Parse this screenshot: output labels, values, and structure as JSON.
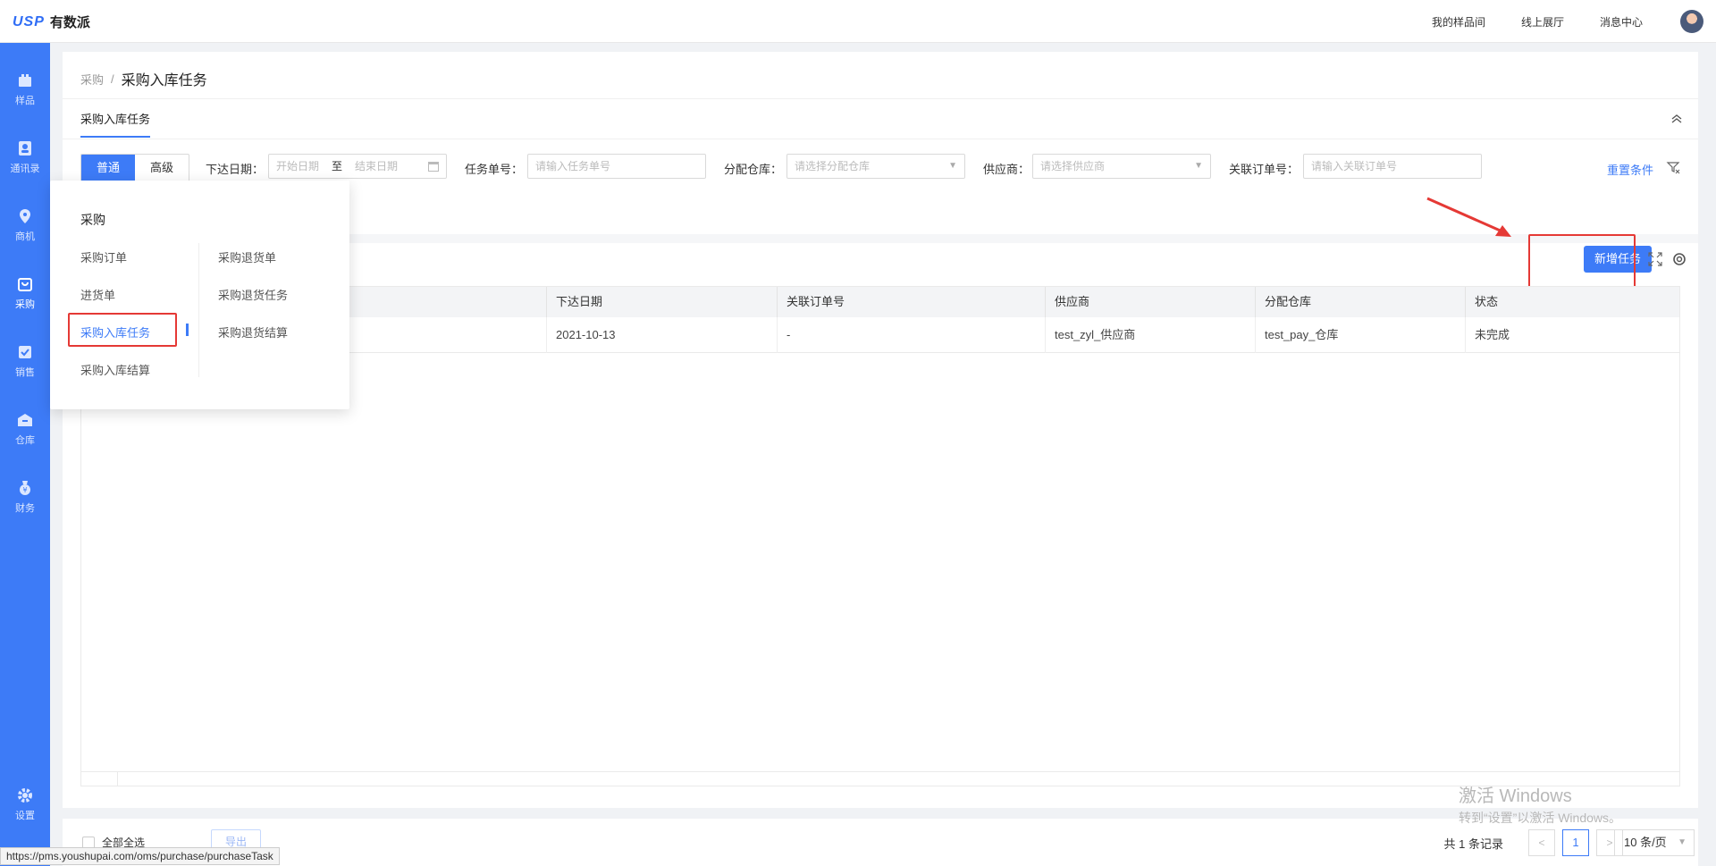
{
  "topbar": {
    "logo_mark": "USP",
    "logo_text": "有数派",
    "links": [
      "我的样品间",
      "线上展厅",
      "消息中心"
    ]
  },
  "sidebar": {
    "items": [
      {
        "label": "样品",
        "icon": "box-icon"
      },
      {
        "label": "通讯录",
        "icon": "contacts-icon"
      },
      {
        "label": "商机",
        "icon": "opportunity-icon"
      },
      {
        "label": "采购",
        "icon": "purchase-icon"
      },
      {
        "label": "销售",
        "icon": "sales-icon"
      },
      {
        "label": "仓库",
        "icon": "warehouse-icon"
      },
      {
        "label": "财务",
        "icon": "finance-icon"
      },
      {
        "label": "设置",
        "icon": "gear-icon"
      }
    ],
    "active_index": 3
  },
  "breadcrumb": {
    "parent": "采购",
    "separator": "/",
    "current": "采购入库任务"
  },
  "tab": {
    "label": "采购入库任务"
  },
  "filters": {
    "mode_normal": "普通",
    "mode_advanced": "高级",
    "date_label": "下达日期：",
    "date_start_placeholder": "开始日期",
    "date_to": "至",
    "date_end_placeholder": "结束日期",
    "task_no_label": "任务单号：",
    "task_no_placeholder": "请输入任务单号",
    "warehouse_label": "分配仓库：",
    "warehouse_placeholder": "请选择分配仓库",
    "supplier_label": "供应商：",
    "supplier_placeholder": "请选择供应商",
    "order_no_label": "关联订单号：",
    "order_no_placeholder": "请输入关联订单号",
    "reset_label": "重置条件"
  },
  "toolbar": {
    "new_task_label": "新增任务"
  },
  "table": {
    "columns": [
      "下达日期",
      "关联订单号",
      "供应商",
      "分配仓库",
      "状态"
    ],
    "rows": [
      {
        "date": "2021-10-13",
        "order_no": "-",
        "supplier": "test_zyl_供应商",
        "warehouse": "test_pay_仓库",
        "status": "未完成"
      }
    ]
  },
  "bottom": {
    "select_all_label": "全部全选",
    "export_label": "导出",
    "total_text": "共 1 条记录",
    "prev": "<",
    "current_page": "1",
    "next": ">",
    "page_size": "10 条/页"
  },
  "flyout": {
    "title": "采购",
    "col1": [
      "采购订单",
      "进货单",
      "采购入库任务",
      "采购入库结算"
    ],
    "col2": [
      "采购退货单",
      "采购退货任务",
      "采购退货结算"
    ],
    "active_item": "采购入库任务"
  },
  "watermark": {
    "line1": "激活 Windows",
    "line2": "转到“设置”以激活 Windows。"
  },
  "status_url": "https://pms.youshupai.com/oms/purchase/purchaseTask",
  "colors": {
    "primary": "#3d7bf7",
    "highlight_red": "#e53935"
  }
}
